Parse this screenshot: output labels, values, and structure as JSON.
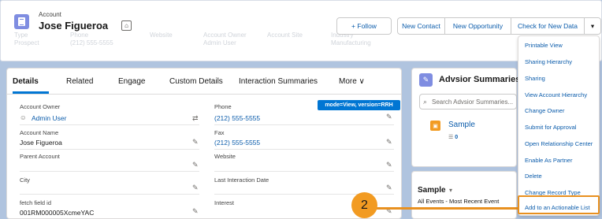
{
  "header": {
    "object_label": "Account",
    "account_name": "Jose Figueroa",
    "highlights": [
      {
        "label": "Type",
        "value": "Prospect"
      },
      {
        "label": "Phone",
        "value": "(212) 555-5555"
      },
      {
        "label": "Website",
        "value": ""
      },
      {
        "label": "Account Owner",
        "value": "Admin User"
      },
      {
        "label": "Account Site",
        "value": ""
      },
      {
        "label": "Industry",
        "value": "Manufacturing"
      }
    ],
    "buttons": {
      "follow": "+ Follow",
      "new_contact": "New Contact",
      "new_opportunity": "New Opportunity",
      "check_new_data": "Check for New Data",
      "more_caret": "▾"
    }
  },
  "menu": {
    "items": [
      "Printable View",
      "Sharing Hierarchy",
      "Sharing",
      "View Account Hierarchy",
      "Change Owner",
      "Submit for Approval",
      "Open Relationship Center",
      "Enable As Partner",
      "Delete",
      "Change Record Type",
      "Add to an Actionable List"
    ]
  },
  "tabs": [
    "Details",
    "Related",
    "Engage",
    "Custom Details",
    "Interaction Summaries",
    "More ∨"
  ],
  "badge": "mode=View, version=RRH",
  "fields": {
    "account_owner": {
      "label": "Account Owner",
      "value": "Admin User"
    },
    "phone": {
      "label": "Phone",
      "value": "(212) 555-5555"
    },
    "account_name": {
      "label": "Account Name",
      "value": "Jose Figueroa"
    },
    "fax": {
      "label": "Fax",
      "value": "(212) 555-5555"
    },
    "parent_account": {
      "label": "Parent Account",
      "value": ""
    },
    "website": {
      "label": "Website",
      "value": ""
    },
    "city": {
      "label": "City",
      "value": ""
    },
    "last_interaction": {
      "label": "Last Interaction Date",
      "value": ""
    },
    "fetch_field": {
      "label": "fetch field id",
      "value": "001RM000005XcmeYAC"
    },
    "interest": {
      "label": "Interest",
      "value": ""
    }
  },
  "advisor_panel": {
    "title": "Advsior Summaries",
    "search_placeholder": "Search Advsior Summaries...",
    "sample_link": "Sample",
    "sample_count": "0",
    "list_title": "Sample",
    "list_subtitle": "All Events - Most Recent Event"
  },
  "callout": {
    "number": "2"
  },
  "colors": {
    "brand_blue": "#0176d3",
    "link_blue": "#0b5cab",
    "callout_orange": "#e8901f",
    "account_icon": "#7f8de1"
  }
}
